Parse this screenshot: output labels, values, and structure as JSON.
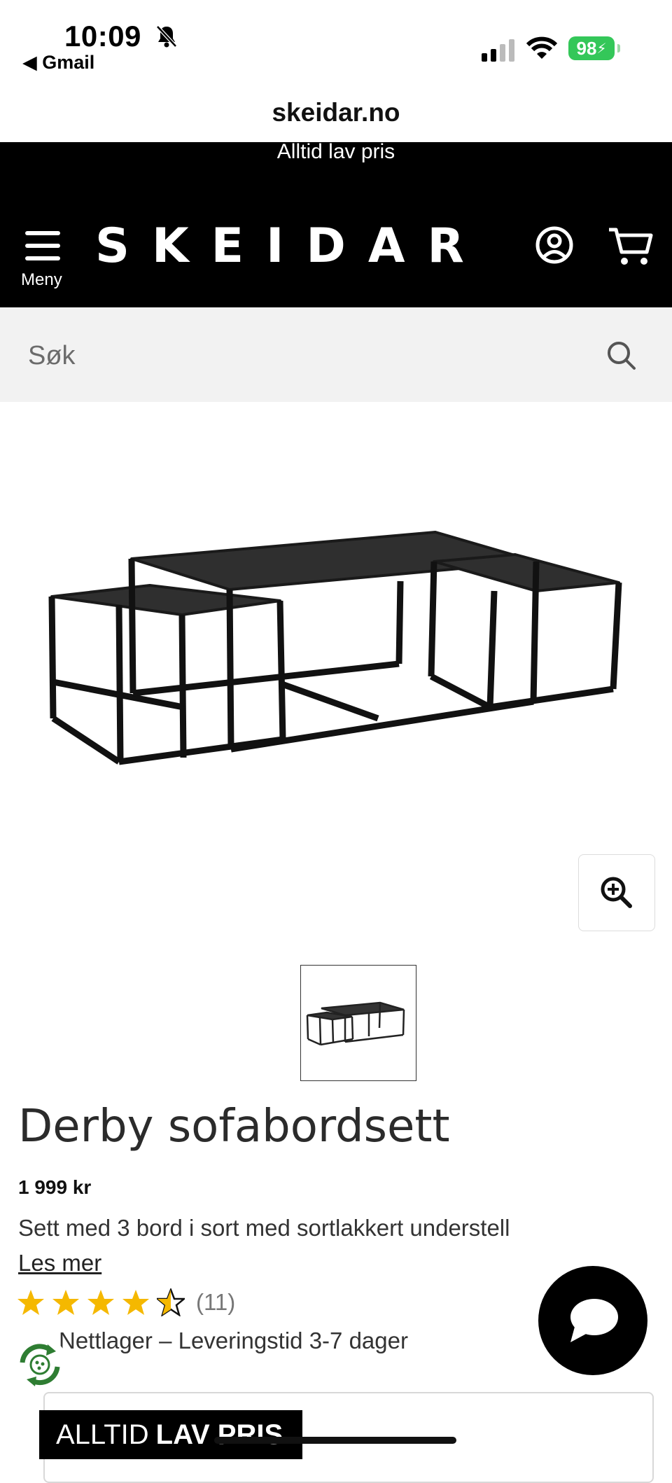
{
  "status_bar": {
    "time": "10:09",
    "back_app": "◀ Gmail",
    "battery": "98"
  },
  "browser": {
    "url": "skeidar.no"
  },
  "header": {
    "promo": "Alltid lav pris",
    "logo": "SKEIDAR",
    "menu_label": "Meny"
  },
  "search": {
    "placeholder": "Søk"
  },
  "product": {
    "title": "Derby sofabordsett",
    "price": "1 999 kr",
    "description": "Sett med 3 bord i sort med sortlakkert understell",
    "read_more": "Les mer",
    "rating": 4.5,
    "rating_count": "(11)",
    "stock": "Nettlager – Leveringstid 3-7 dager"
  },
  "promo_card": {
    "tag_regular": "ALLTID",
    "tag_bold": "LAV PRIS"
  },
  "colors": {
    "header_bg": "#000000",
    "star": "#f5b800",
    "battery": "#34c759",
    "search_bg": "#f2f2f2"
  },
  "icons": [
    "bell-slash-icon",
    "signal-icon",
    "wifi-icon",
    "battery-icon",
    "hamburger-icon",
    "account-icon",
    "cart-icon",
    "search-icon",
    "zoom-in-icon",
    "star-icon",
    "chat-icon",
    "recycle-icon"
  ]
}
